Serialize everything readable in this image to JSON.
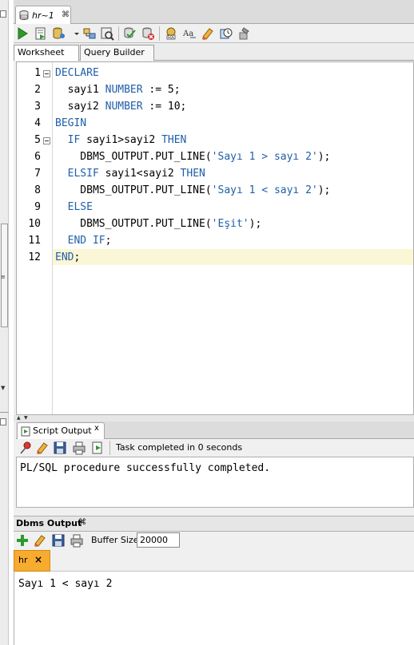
{
  "document_tab": {
    "title": "hr~1",
    "close": "⌘"
  },
  "sub_tabs": {
    "worksheet": "Worksheet",
    "query_builder": "Query Builder"
  },
  "editor": {
    "line_numbers": [
      "1",
      "2",
      "3",
      "4",
      "5",
      "6",
      "7",
      "8",
      "9",
      "10",
      "11",
      "12"
    ],
    "lines": [
      [
        {
          "t": "DECLARE",
          "c": "kw"
        }
      ],
      [
        {
          "t": "  sayi1 ",
          "c": ""
        },
        {
          "t": "NUMBER",
          "c": "kw"
        },
        {
          "t": " := 5;",
          "c": ""
        }
      ],
      [
        {
          "t": "  sayi2 ",
          "c": ""
        },
        {
          "t": "NUMBER",
          "c": "kw"
        },
        {
          "t": " := 10;",
          "c": ""
        }
      ],
      [
        {
          "t": "BEGIN",
          "c": "kw"
        }
      ],
      [
        {
          "t": "  ",
          "c": ""
        },
        {
          "t": "IF",
          "c": "kw"
        },
        {
          "t": " sayi1>sayi2 ",
          "c": ""
        },
        {
          "t": "THEN",
          "c": "kw"
        }
      ],
      [
        {
          "t": "    DBMS_OUTPUT.PUT_LINE(",
          "c": ""
        },
        {
          "t": "'Sayı 1 > sayı 2'",
          "c": "str"
        },
        {
          "t": ");",
          "c": ""
        }
      ],
      [
        {
          "t": "  ",
          "c": ""
        },
        {
          "t": "ELSIF",
          "c": "kw"
        },
        {
          "t": " sayi1<sayi2 ",
          "c": ""
        },
        {
          "t": "THEN",
          "c": "kw"
        }
      ],
      [
        {
          "t": "    DBMS_OUTPUT.PUT_LINE(",
          "c": ""
        },
        {
          "t": "'Sayı 1 < sayı 2'",
          "c": "str"
        },
        {
          "t": ");",
          "c": ""
        }
      ],
      [
        {
          "t": "  ",
          "c": ""
        },
        {
          "t": "ELSE",
          "c": "kw"
        }
      ],
      [
        {
          "t": "    DBMS_OUTPUT.PUT_LINE(",
          "c": ""
        },
        {
          "t": "'Eşit'",
          "c": "str"
        },
        {
          "t": ");",
          "c": ""
        }
      ],
      [
        {
          "t": "  ",
          "c": ""
        },
        {
          "t": "END IF",
          "c": "kw"
        },
        {
          "t": ";",
          "c": ""
        }
      ],
      [
        {
          "t": "END",
          "c": "kw"
        },
        {
          "t": ";",
          "c": ""
        }
      ]
    ]
  },
  "script_output": {
    "tab_label": "Script Output",
    "tab_close": "x",
    "status": "Task completed in 0 seconds",
    "text": "PL/SQL procedure successfully completed."
  },
  "dbms_output": {
    "header": "Dbms Output",
    "header_close": "⌘",
    "buffer_label": "Buffer Size:",
    "buffer_value": "20000",
    "connection_tab": "hr",
    "connection_close": "×",
    "text": "Sayı 1 < sayı 2"
  },
  "colors": {
    "keyword": "#1f5fa8",
    "current_line": "#fbf6d6",
    "connection_tab": "#f7ab2f",
    "run_green": "#2c9a2c"
  },
  "icons": [
    "run-statement-icon",
    "run-script-icon",
    "autotrace-icon",
    "explain-plan-icon",
    "sql-tuning-icon",
    "commit-icon",
    "rollback-icon",
    "unshared-sql-icon",
    "to-upper-lower-icon",
    "clear-icon",
    "sql-history-icon",
    "format-icon"
  ]
}
